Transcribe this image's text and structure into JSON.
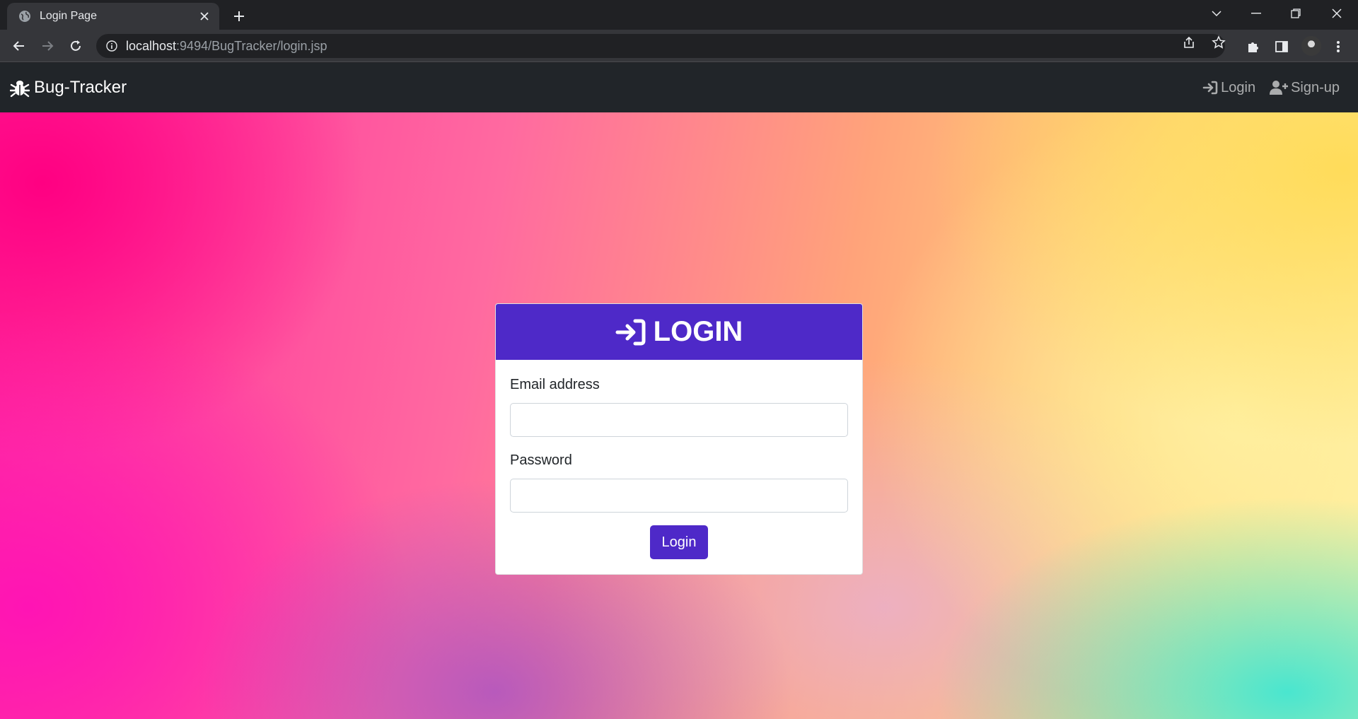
{
  "browser": {
    "tab_title": "Login Page",
    "url_host": "localhost",
    "url_rest": ":9494/BugTracker/login.jsp"
  },
  "app": {
    "brand": "Bug-Tracker",
    "nav": {
      "login": "Login",
      "signup": "Sign-up"
    }
  },
  "login_card": {
    "title": "LOGIN",
    "email_label": "Email address",
    "email_value": "",
    "password_label": "Password",
    "password_value": "",
    "submit_label": "Login"
  },
  "colors": {
    "accent": "#4e29c8",
    "navbar": "#212529"
  }
}
